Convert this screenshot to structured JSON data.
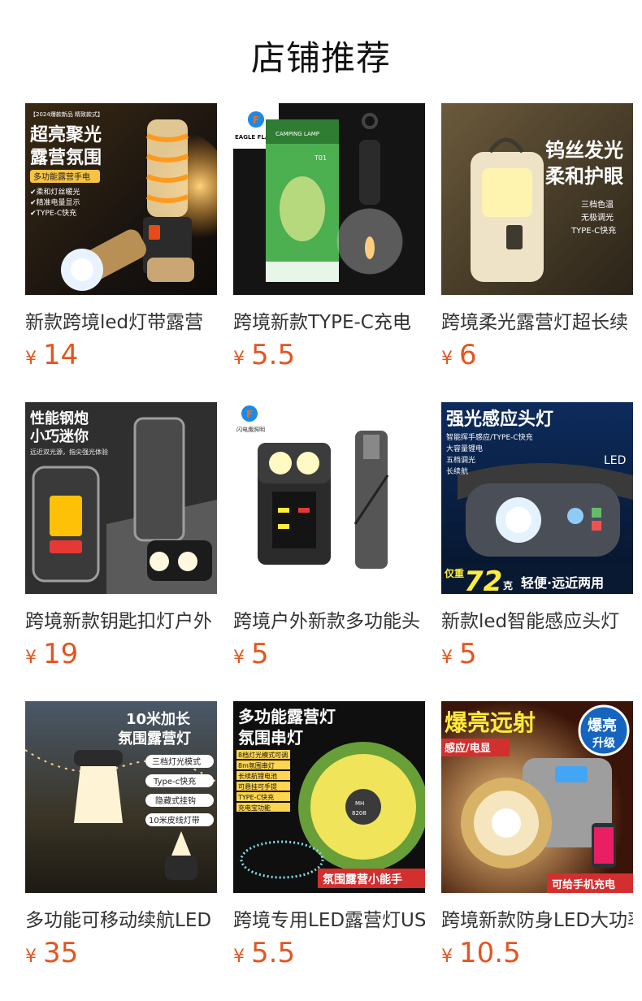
{
  "page": {
    "title": "店铺推荐"
  },
  "products": [
    {
      "name": "新款跨境led灯带露营",
      "price": "14",
      "currency": "¥",
      "image_text": [
        "【2024爆款新品 精致款式】",
        "超亮聚光",
        "露营氛围",
        "多功能露营手电",
        "✔柔和灯丝暖光",
        "✔精准电量显示",
        "✔TYPE-C快充"
      ]
    },
    {
      "name": "跨境新款TYPE-C充电",
      "price": "5.5",
      "currency": "¥",
      "image_text": [
        "EAGLE FLASH",
        "CAMPING LAMP",
        "T01"
      ]
    },
    {
      "name": "跨境柔光露营灯超长续",
      "price": "6",
      "currency": "¥",
      "image_text": [
        "钨丝发光",
        "柔和护眼",
        "三档色温",
        "无极调光",
        "TYPE-C快充"
      ]
    },
    {
      "name": "跨境新款钥匙扣灯户外",
      "price": "19",
      "currency": "¥",
      "image_text": [
        "性能钢炮",
        "小巧迷你",
        "远近双光源，指尖强光体验"
      ]
    },
    {
      "name": "跨境户外新款多功能头",
      "price": "5",
      "currency": "¥",
      "image_text": [
        "闪电鹰照明"
      ]
    },
    {
      "name": "新款led智能感应头灯",
      "price": "5",
      "currency": "¥",
      "image_text": [
        "强光感应头灯",
        "智能挥手感应/TYPE-C快充",
        "大容量锂电",
        "五档调光",
        "长续航",
        "LED",
        "仅重",
        "72",
        "克",
        "轻便·远近两用"
      ]
    },
    {
      "name": "多功能可移动续航LED",
      "price": "35",
      "currency": "¥",
      "image_text": [
        "10米加长",
        "氛围露营灯",
        "三档灯光模式",
        "Type-c快充",
        "隐藏式挂钩",
        "10米皮线灯带"
      ]
    },
    {
      "name": "跨境专用LED露营灯USB",
      "price": "5.5",
      "currency": "¥",
      "image_text": [
        "多功能露营灯",
        "氛围串灯",
        "8档灯光模式可调",
        "8m氛围串灯",
        "长续航锂电池",
        "可悬挂可手提",
        "TYPE-C快充",
        "充电宝功能",
        "MH",
        "8208",
        "氛围露营小能手"
      ]
    },
    {
      "name": "跨境新款防身LED大功率",
      "price": "10.5",
      "currency": "¥",
      "image_text": [
        "爆亮远射",
        "爆亮",
        "升级",
        "感应/电显",
        "可给手机充电"
      ]
    }
  ],
  "colors": {
    "price": "#e4551f",
    "title": "#111111",
    "name": "#333333"
  }
}
